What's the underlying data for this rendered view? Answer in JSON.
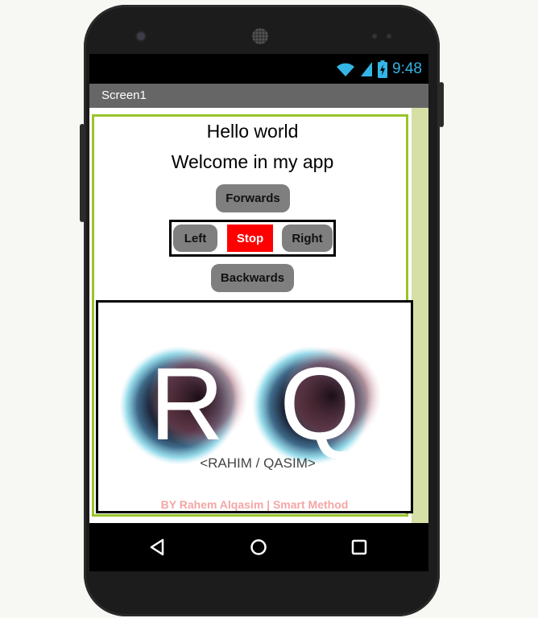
{
  "status_bar": {
    "time": "9:48"
  },
  "titlebar": {
    "title": "Screen1"
  },
  "labels": {
    "hello": "Hello world",
    "welcome": "Welcome in my app"
  },
  "buttons": {
    "forwards": "Forwards",
    "left": "Left",
    "stop": "Stop",
    "right": "Right",
    "backwards": "Backwards"
  },
  "logo": {
    "letters": [
      "R",
      "Q"
    ],
    "caption": "<RAHIM / QASIM>"
  },
  "credit": "BY Rahem Alqasim | Smart Method",
  "colors": {
    "status_time": "#33b5e5",
    "titlebar": "#666666",
    "button": "#7f7f7f",
    "stop_button": "#ff0000",
    "arrangement_border": "#9ac42a",
    "scroll_strip": "#d5dfa6",
    "credit_text": "#f4a6a6"
  },
  "icons": [
    "wifi-icon",
    "signal-icon",
    "battery-charging-icon",
    "back-icon",
    "home-icon",
    "recents-icon"
  ]
}
